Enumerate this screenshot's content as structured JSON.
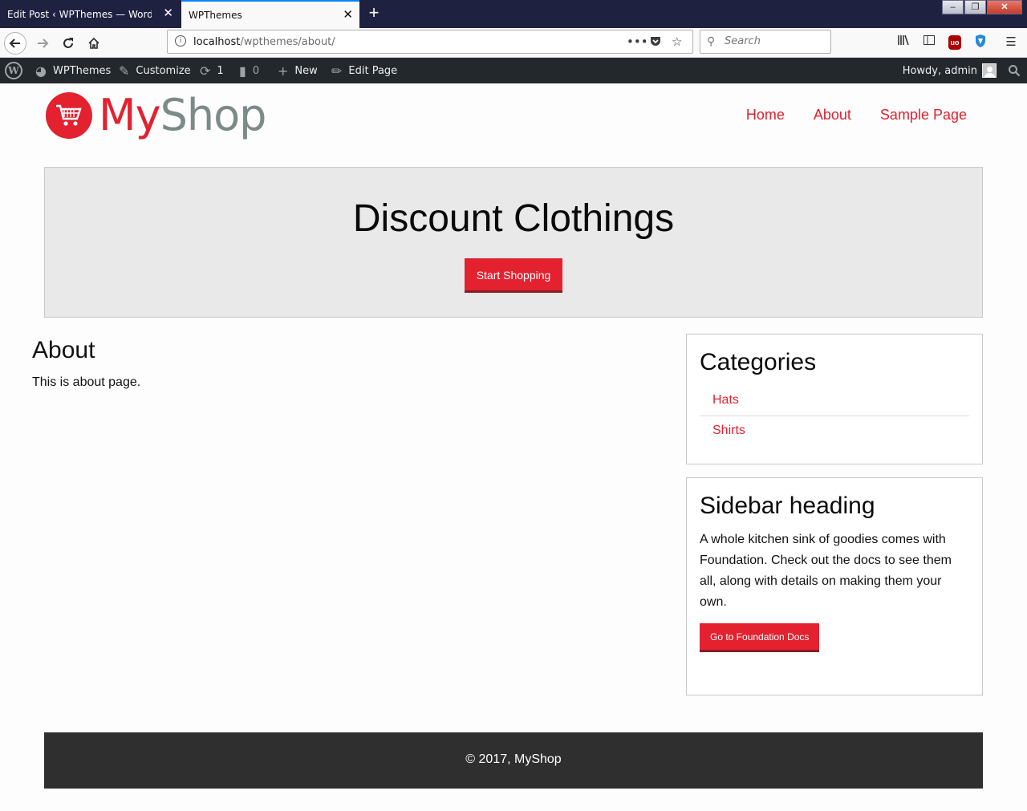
{
  "browser": {
    "tabs": [
      {
        "title": "Edit Post ‹ WPThemes — WordPress",
        "active": false
      },
      {
        "title": "WPThemes",
        "active": true
      }
    ],
    "url_host": "localhost",
    "url_path": "/wpthemes/about/",
    "search_placeholder": "Search",
    "icons": [
      "back-icon",
      "forward-icon",
      "reload-icon",
      "home-icon",
      "more-icon",
      "pocket-icon",
      "bookmark-star-icon",
      "library-icon",
      "sidebar-icon",
      "ublock-icon",
      "shield-icon",
      "menu-icon"
    ]
  },
  "admin_bar": {
    "site_name": "WPThemes",
    "customize": "Customize",
    "updates_count": "1",
    "comments_count": "0",
    "new": "New",
    "edit_page": "Edit Page",
    "howdy": "Howdy, admin"
  },
  "site": {
    "logo_my": "My",
    "logo_shop": "Shop",
    "menu": [
      "Home",
      "About",
      "Sample Page"
    ],
    "accent_color": "#e3212f"
  },
  "hero": {
    "title": "Discount Clothings",
    "button": "Start Shopping"
  },
  "page": {
    "title": "About",
    "body": "This is about page."
  },
  "sidebar": {
    "categories_title": "Categories",
    "categories": [
      "Hats",
      "Shirts"
    ],
    "widget_title": "Sidebar heading",
    "widget_text": "A whole kitchen sink of goodies comes with Foundation. Check out the docs to see them all, along with details on making them your own.",
    "widget_button": "Go to Foundation Docs"
  },
  "footer": {
    "text": "© 2017, MyShop"
  }
}
